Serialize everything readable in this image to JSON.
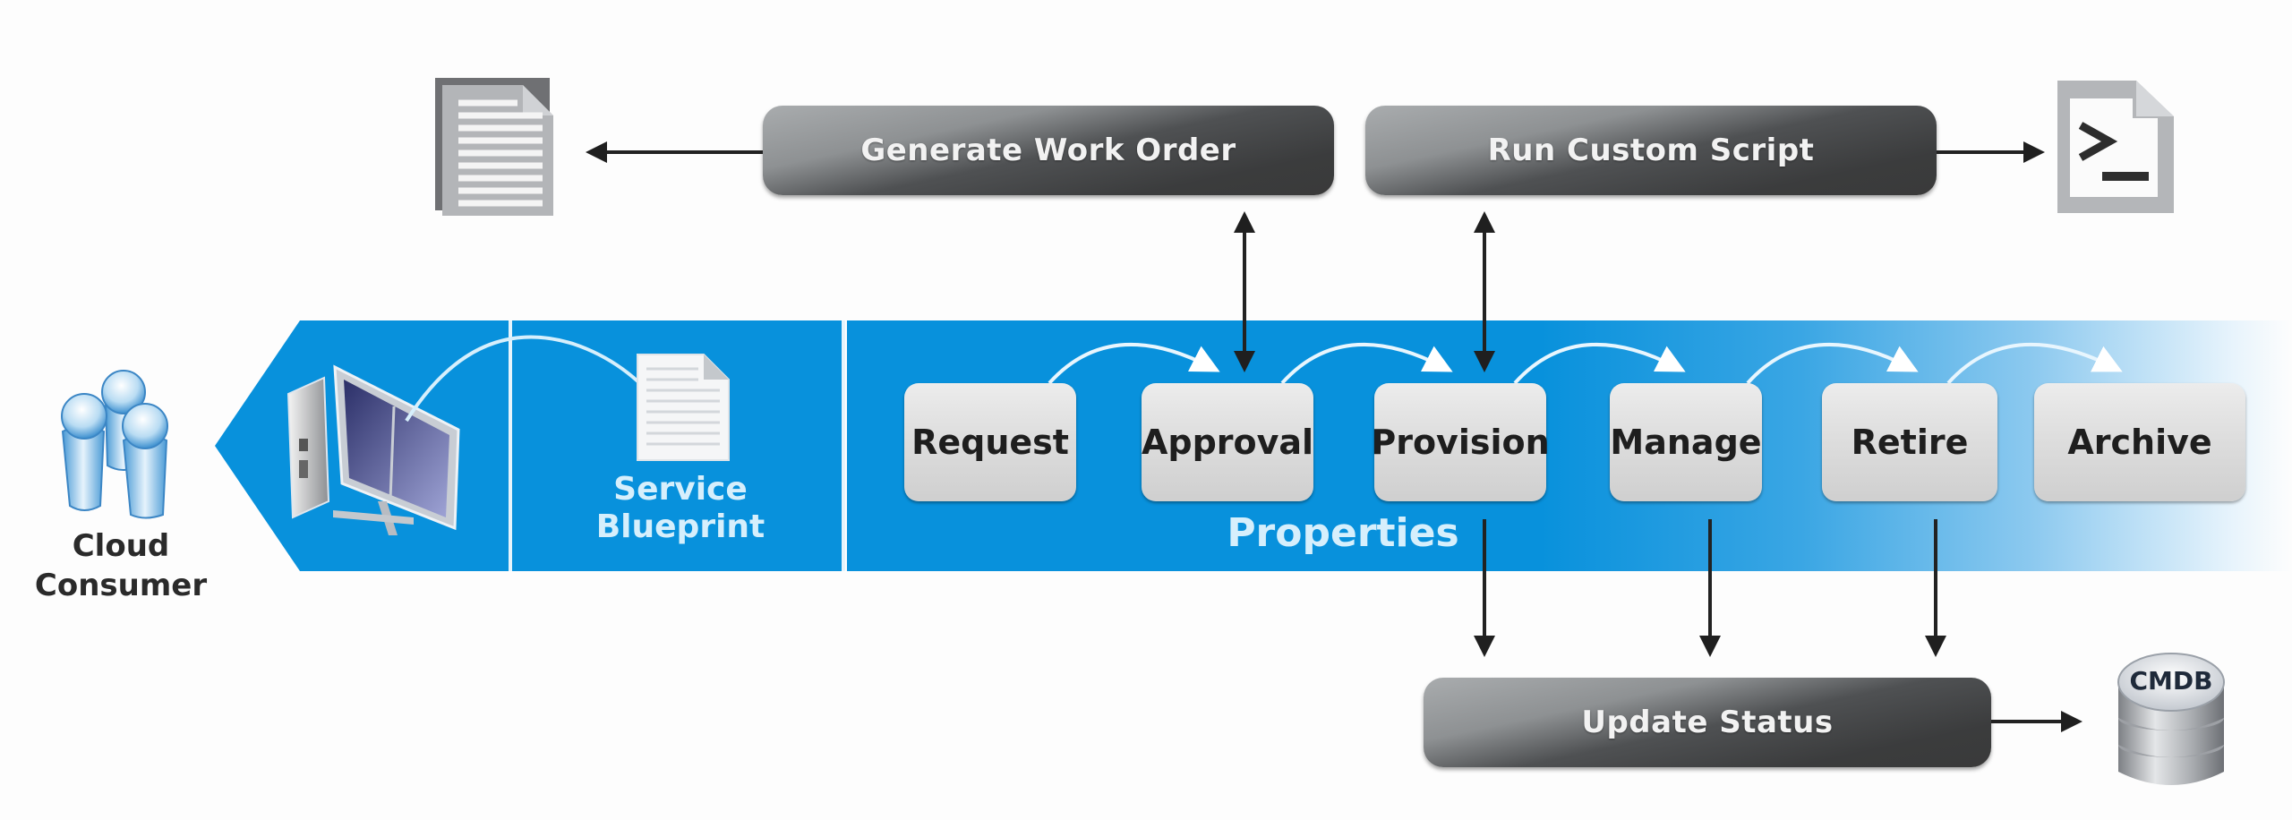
{
  "diagram": {
    "actor": {
      "label_line1": "Cloud",
      "label_line2": "Consumer",
      "icon": "users-group-icon"
    },
    "portal": {
      "icon": "computer-monitor-icon"
    },
    "blueprint": {
      "label_line1": "Service",
      "label_line2": "Blueprint",
      "icon": "document-icon"
    },
    "lifecycle": {
      "stages": [
        {
          "label": "Request"
        },
        {
          "label": "Approval"
        },
        {
          "label": "Provision"
        },
        {
          "label": "Manage"
        },
        {
          "label": "Retire"
        },
        {
          "label": "Archive"
        }
      ],
      "footer_label": "Properties"
    },
    "actions": {
      "work_order": {
        "label": "Generate Work Order",
        "output_icon": "work-order-document-icon",
        "connects_to": "Approval"
      },
      "custom_script": {
        "label": "Run Custom Script",
        "output_icon": "terminal-script-icon",
        "connects_to": "Provision"
      },
      "update_status": {
        "label": "Update Status",
        "sources": [
          "Provision",
          "Manage",
          "Retire"
        ],
        "output_icon": "database-icon"
      }
    },
    "database": {
      "label": "CMDB"
    },
    "colors": {
      "band_blue": "#0891dc",
      "pill_dark": "#3b3c3d",
      "stage_gray": "#dedede",
      "label_light_blue": "#d6effc"
    }
  }
}
